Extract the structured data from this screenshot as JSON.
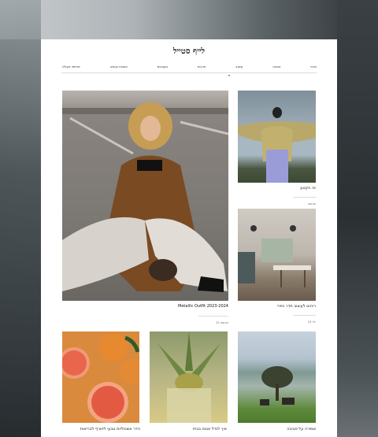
{
  "site": {
    "title": "לייף סטייל"
  },
  "nav": {
    "items": [
      "ביוטי",
      "אופנה",
      "עיצוב",
      "תרבות",
      "מעצבים",
      "אמנות ועיצוב",
      "שיתופי פעולה"
    ]
  },
  "posts": [
    {
      "caption": "Metallic Outfit 2023-2024",
      "date": "אוגוסט 23"
    },
    {
      "caption": "זה הקטע",
      "date": "אוגוסט"
    },
    {
      "caption": "ריהוט לעיצוב חדר כפרי",
      "date": "יולי 23"
    },
    {
      "caption": "שמירה על סביבה",
      "date": ""
    },
    {
      "caption": "איך לגדל אננס בבית",
      "date": ""
    },
    {
      "caption": "הדר אשכוליות טבעי לחורף לבריאות",
      "date": ""
    }
  ]
}
